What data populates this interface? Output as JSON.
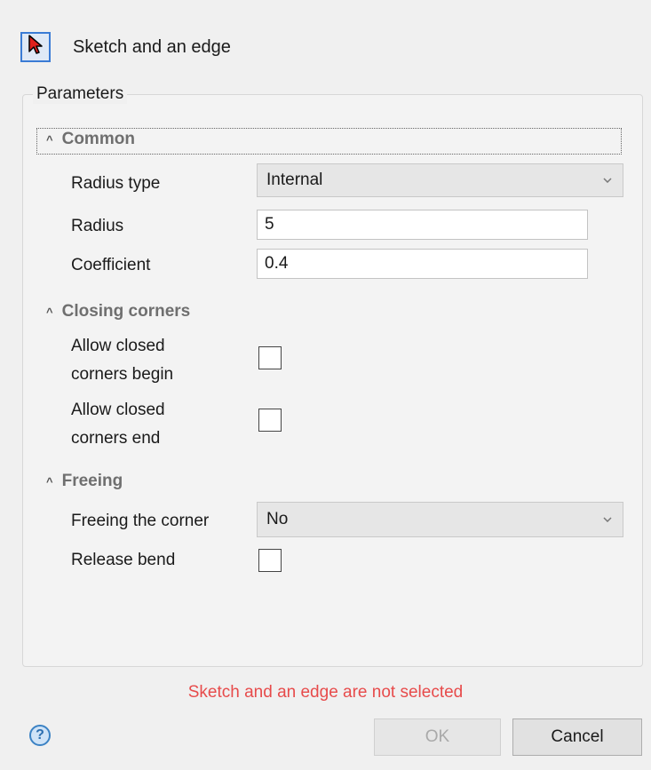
{
  "header": {
    "tool_icon": "cursor-arrow-icon",
    "text": "Sketch and an edge"
  },
  "parameters": {
    "title": "Parameters",
    "sections": {
      "common": {
        "title": "Common",
        "radius_type": {
          "label": "Radius type",
          "value": "Internal"
        },
        "radius": {
          "label": "Radius",
          "value": "5"
        },
        "coefficient": {
          "label": "Coefficient",
          "value": "0.4"
        }
      },
      "closing_corners": {
        "title": "Closing corners",
        "begin": {
          "label_line1": "Allow closed",
          "label_line2": "corners begin",
          "checked": false
        },
        "end": {
          "label_line1": "Allow closed",
          "label_line2": "corners end",
          "checked": false
        }
      },
      "freeing": {
        "title": "Freeing",
        "freeing_corner": {
          "label": "Freeing the corner",
          "value": "No"
        },
        "release_bend": {
          "label": "Release bend",
          "checked": false
        }
      }
    }
  },
  "status": {
    "text": "Sketch and an edge are not selected",
    "color": "#e74b4b"
  },
  "footer": {
    "help_label": "?",
    "ok_label": "OK",
    "cancel_label": "Cancel"
  },
  "colors": {
    "accent": "#3a7bd5",
    "error": "#e74b4b"
  }
}
